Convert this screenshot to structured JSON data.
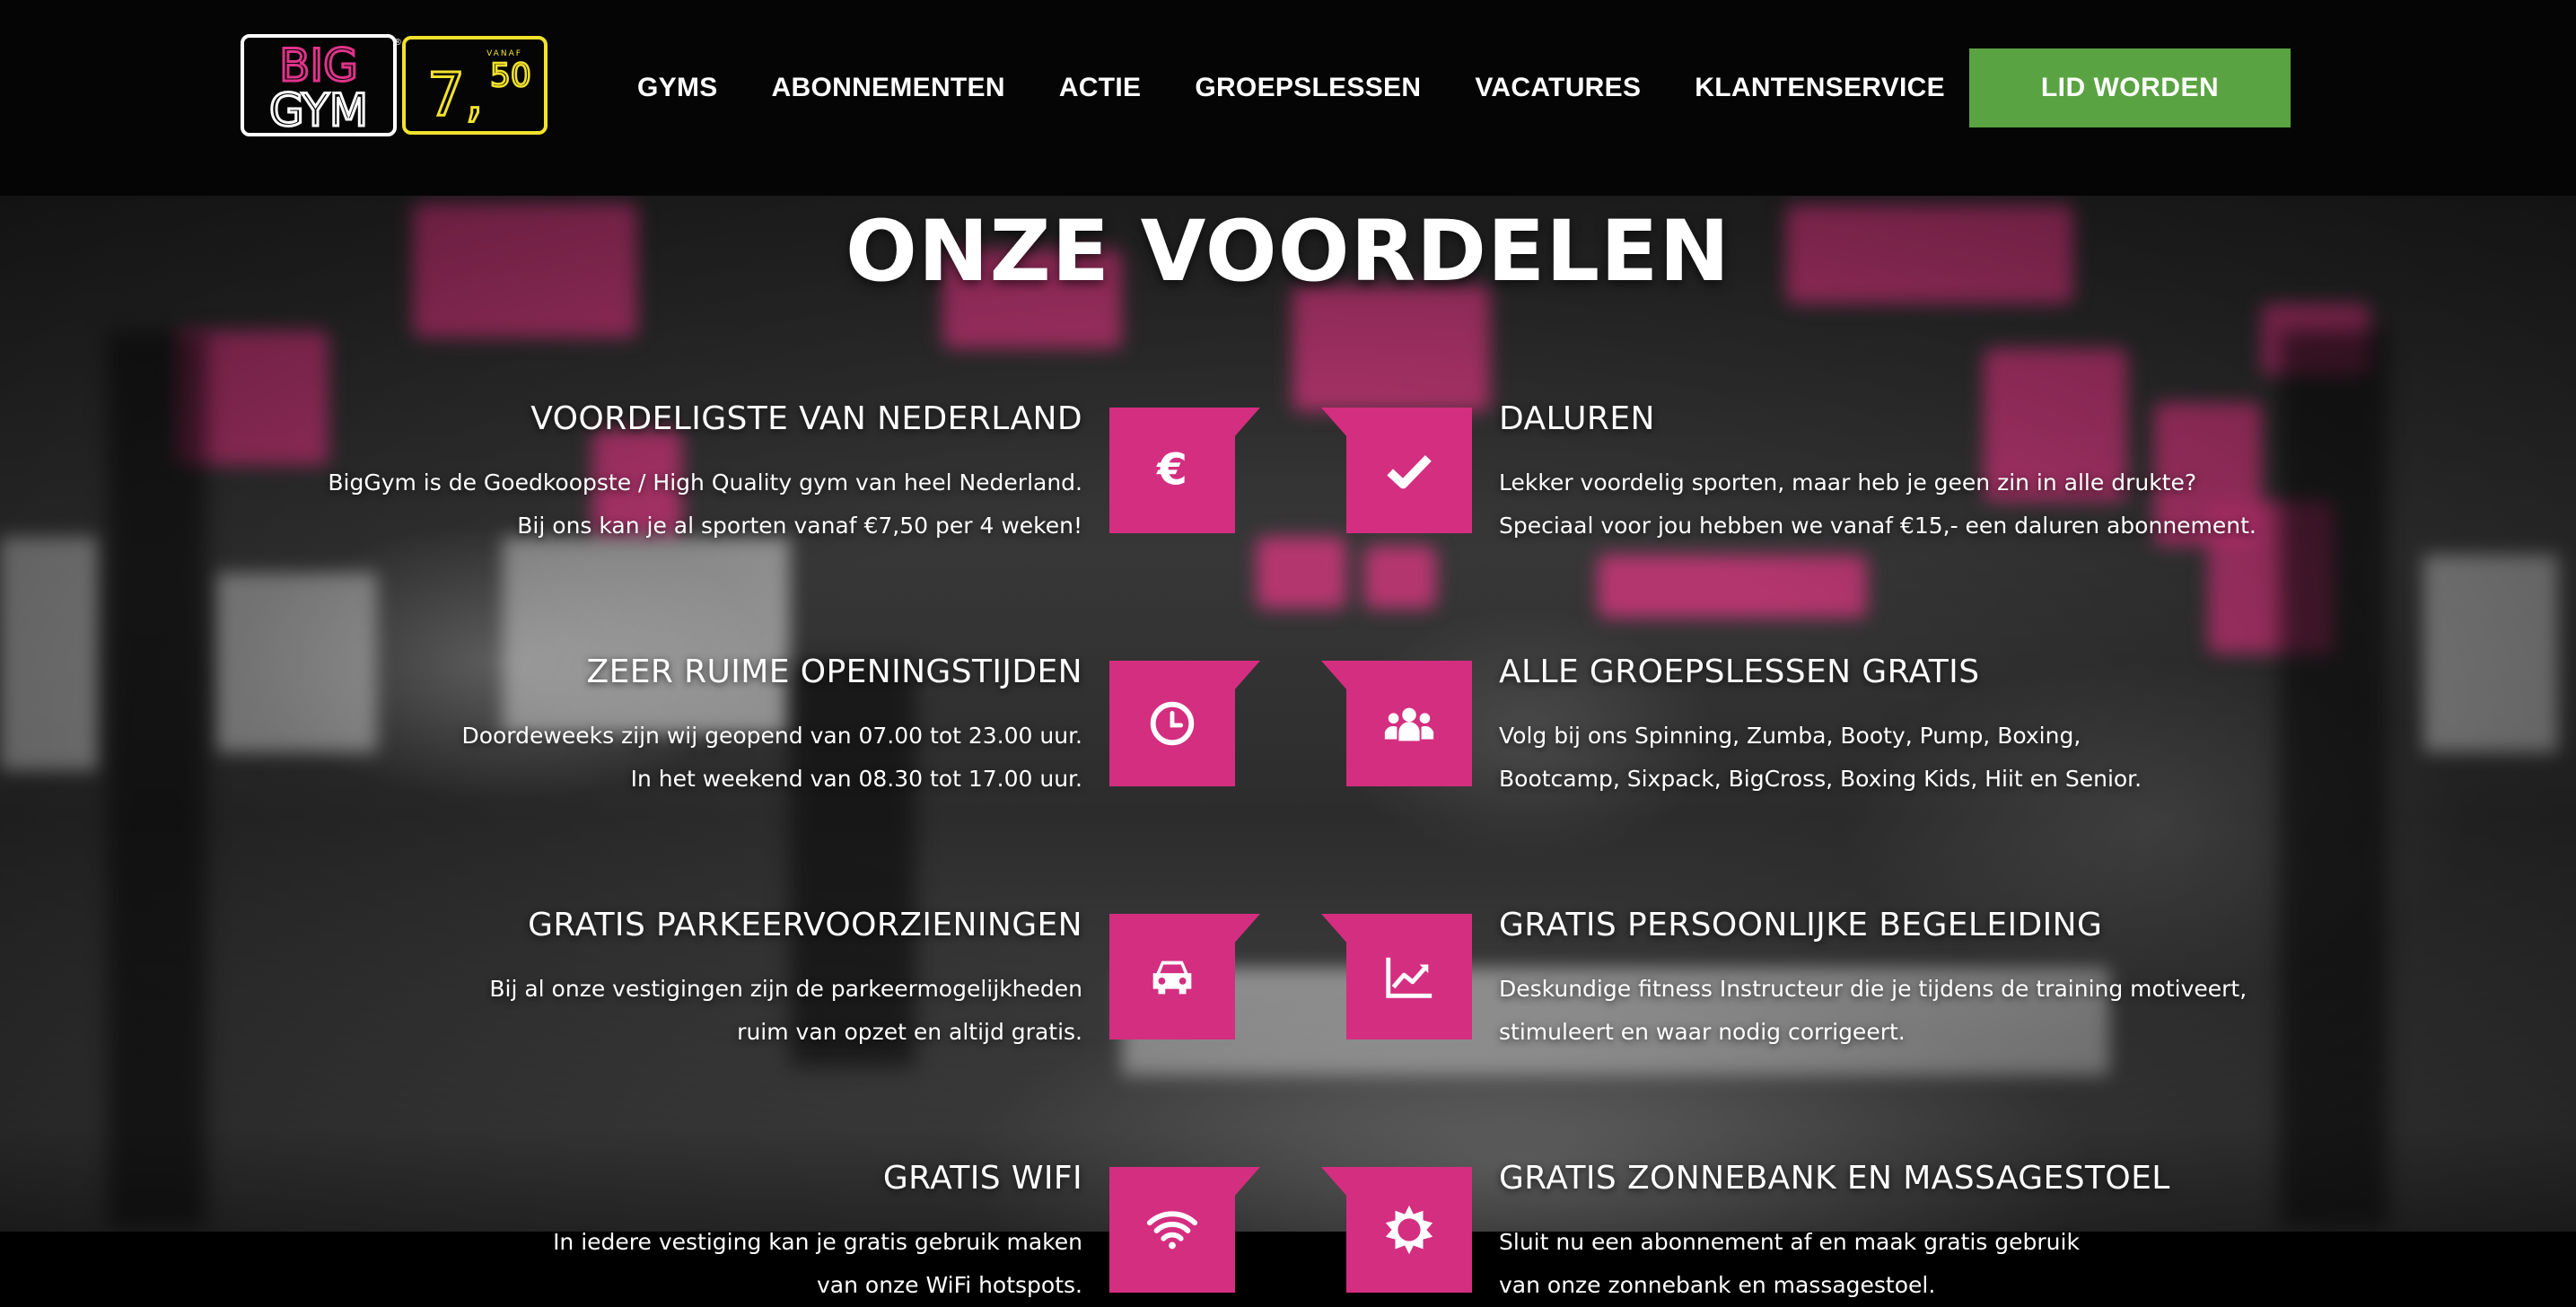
{
  "header": {
    "logo": {
      "brand_top": "BIG",
      "brand_bottom": "GYM",
      "badge_small": "VANAF",
      "badge_price_main": "7,",
      "badge_price_cents": "50",
      "registered": "®"
    },
    "nav": [
      {
        "label": "GYMS"
      },
      {
        "label": "ABONNEMENTEN"
      },
      {
        "label": "ACTIE"
      },
      {
        "label": "GROEPSLESSEN"
      },
      {
        "label": "VACATURES"
      },
      {
        "label": "KLANTENSERVICE"
      }
    ],
    "cta_label": "LID WORDEN"
  },
  "main": {
    "title": "ONZE VOORDELEN",
    "features_left": [
      {
        "title": "VOORDELIGSTE VAN NEDERLAND",
        "line1": "BigGym is de Goedkoopste / High Quality gym van heel Nederland.",
        "line2": "Bij ons kan je al sporten vanaf €7,50 per 4 weken!",
        "icon": "euro-icon"
      },
      {
        "title": "ZEER RUIME OPENINGSTIJDEN",
        "line1": "Doordeweeks zijn wij geopend van 07.00 tot 23.00 uur.",
        "line2": "In het weekend van 08.30 tot 17.00 uur.",
        "icon": "clock-icon"
      },
      {
        "title": "GRATIS PARKEERVOORZIENINGEN",
        "line1": "Bij al onze vestigingen zijn de parkeermogelijkheden",
        "line2": "ruim van opzet en altijd gratis.",
        "icon": "car-icon"
      },
      {
        "title": "GRATIS WIFI",
        "line1": "In iedere vestiging kan je gratis gebruik maken",
        "line2": "van onze WiFi hotspots.",
        "icon": "wifi-icon"
      }
    ],
    "features_right": [
      {
        "title": "DALUREN",
        "line1": "Lekker voordelig sporten, maar heb je geen zin in alle drukte?",
        "line2": "Speciaal voor jou hebben we vanaf €15,- een daluren abonnement.",
        "icon": "checkmark-icon"
      },
      {
        "title": "ALLE GROEPSLESSEN GRATIS",
        "line1": "Volg bij ons Spinning, Zumba, Booty, Pump, Boxing,",
        "line2": "Bootcamp, Sixpack, BigCross, Boxing Kids, Hiit en Senior.",
        "icon": "group-icon"
      },
      {
        "title": "GRATIS PERSOONLIJKE BEGELEIDING",
        "line1": "Deskundige fitness Instructeur die je tijdens de training motiveert,",
        "line2": "stimuleert en waar nodig corrigeert.",
        "icon": "chart-icon"
      },
      {
        "title": "GRATIS ZONNEBANK EN MASSAGESTOEL",
        "line1": "Sluit nu een abonnement af en maak gratis gebruik",
        "line2": "van onze zonnebank en massagestoel.",
        "icon": "sun-icon"
      }
    ]
  },
  "colors": {
    "accent_pink": "#d42e80",
    "cta_green": "#5aa342",
    "logo_yellow": "#f2e22c"
  }
}
